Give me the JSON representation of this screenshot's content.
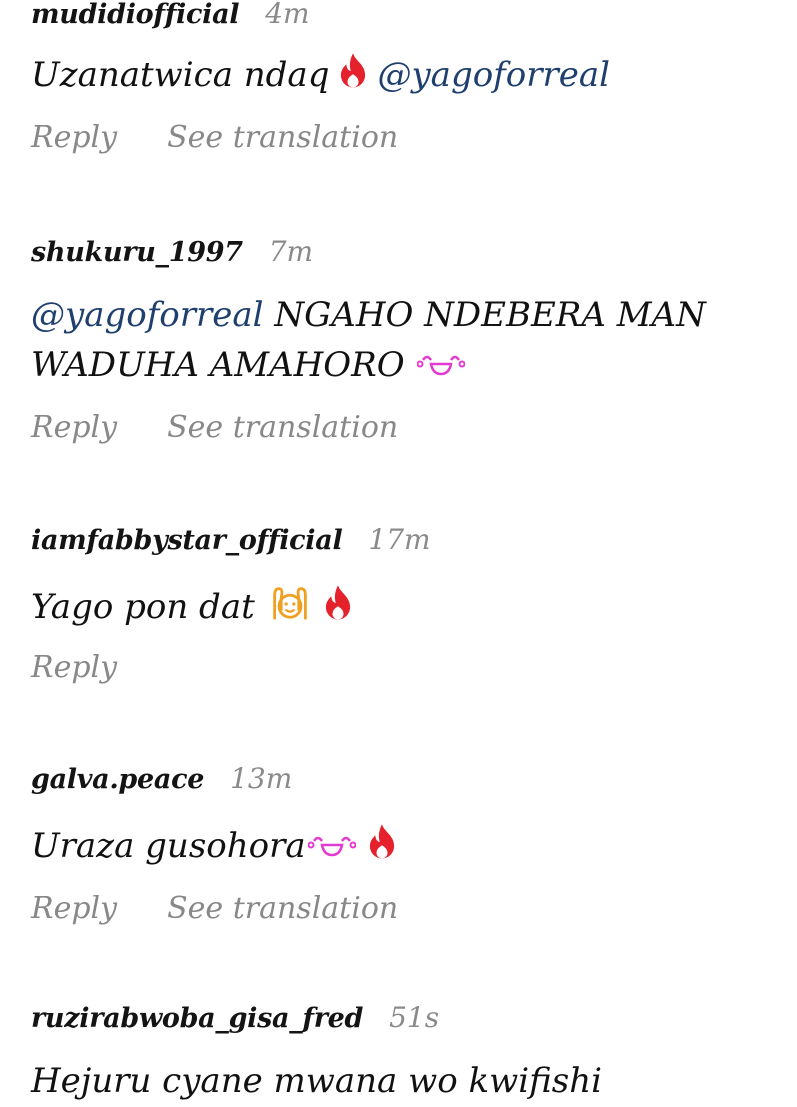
{
  "comments": [
    {
      "username": "mudidiofficial",
      "time": "4m",
      "text_before": "Uzanatwica ndaq",
      "emoji_1": "fire-icon",
      "mention": "@yagoforreal",
      "text_after": "",
      "actions": {
        "reply": "Reply",
        "translate": "See translation"
      }
    },
    {
      "username": "shukuru_1997",
      "time": "7m",
      "mention": "@yagoforreal",
      "text_line1": " NGAHO NDEBERA MAN",
      "text_line2": "WADUHA AMAHORO ",
      "emoji_1": "tears-of-joy-icon",
      "actions": {
        "reply": "Reply",
        "translate": "See translation"
      }
    },
    {
      "username": "iamfabbystar_official",
      "time": "17m",
      "text": "Yago pon dat ",
      "emoji_1": "raising-hands-face-icon",
      "emoji_2": "fire-icon",
      "actions": {
        "reply": "Reply"
      }
    },
    {
      "username": "galva.peace",
      "time": "13m",
      "text": "Uraza gusohora",
      "emoji_1": "tears-of-joy-icon",
      "emoji_2": "fire-icon",
      "actions": {
        "reply": "Reply",
        "translate": "See translation"
      }
    },
    {
      "username": "ruzirabwoba_gisa_fred",
      "time": "51s",
      "text": "Hejuru cyane mwana wo kwifishi"
    }
  ],
  "colors": {
    "mention": "#1f3f6e",
    "fire": "#e5212b",
    "tears": "#e23bd0",
    "hands": "#f0a020",
    "muted": "#888888"
  }
}
